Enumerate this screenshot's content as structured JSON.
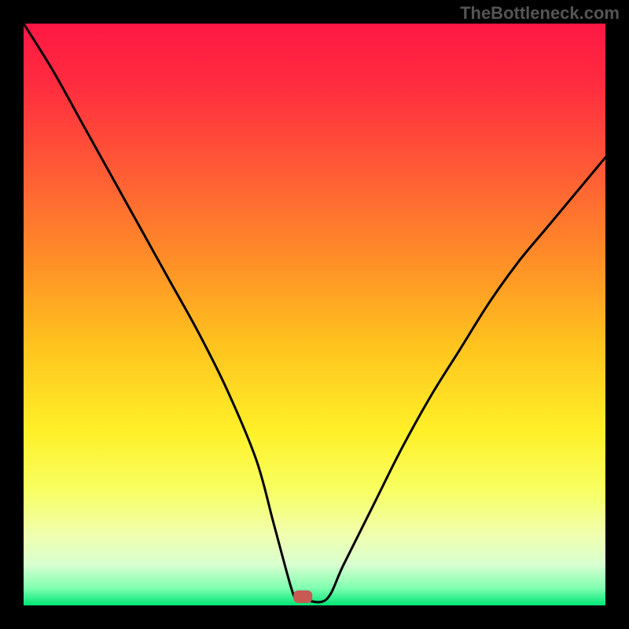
{
  "watermark": "TheBottleneck.com",
  "chart_data": {
    "type": "line",
    "title": "",
    "xlabel": "",
    "ylabel": "",
    "xlim": [
      0,
      100
    ],
    "ylim": [
      0,
      100
    ],
    "grid": false,
    "legend": false,
    "series": [
      {
        "name": "curve",
        "x": [
          0,
          5,
          10,
          15,
          20,
          25,
          30,
          35,
          40,
          43,
          46,
          47,
          48,
          52,
          55,
          60,
          65,
          70,
          75,
          80,
          85,
          90,
          95,
          100
        ],
        "y": [
          100,
          92,
          83,
          74,
          65,
          56,
          47,
          37,
          25,
          14,
          3,
          1,
          1,
          1,
          7,
          17,
          27,
          36,
          44,
          52,
          59,
          65,
          71,
          77
        ]
      }
    ],
    "marker": {
      "x": 48,
      "y": 1.5
    },
    "background_gradient": {
      "stops": [
        {
          "offset": 0.0,
          "color": "#ff1744"
        },
        {
          "offset": 0.1,
          "color": "#ff2b3f"
        },
        {
          "offset": 0.25,
          "color": "#ff5a36"
        },
        {
          "offset": 0.4,
          "color": "#ff8c28"
        },
        {
          "offset": 0.55,
          "color": "#ffc21e"
        },
        {
          "offset": 0.7,
          "color": "#fff028"
        },
        {
          "offset": 0.8,
          "color": "#f8ff60"
        },
        {
          "offset": 0.88,
          "color": "#f0ffb0"
        },
        {
          "offset": 0.93,
          "color": "#d8ffd0"
        },
        {
          "offset": 0.97,
          "color": "#80ffb0"
        },
        {
          "offset": 1.0,
          "color": "#00e676"
        }
      ]
    }
  }
}
